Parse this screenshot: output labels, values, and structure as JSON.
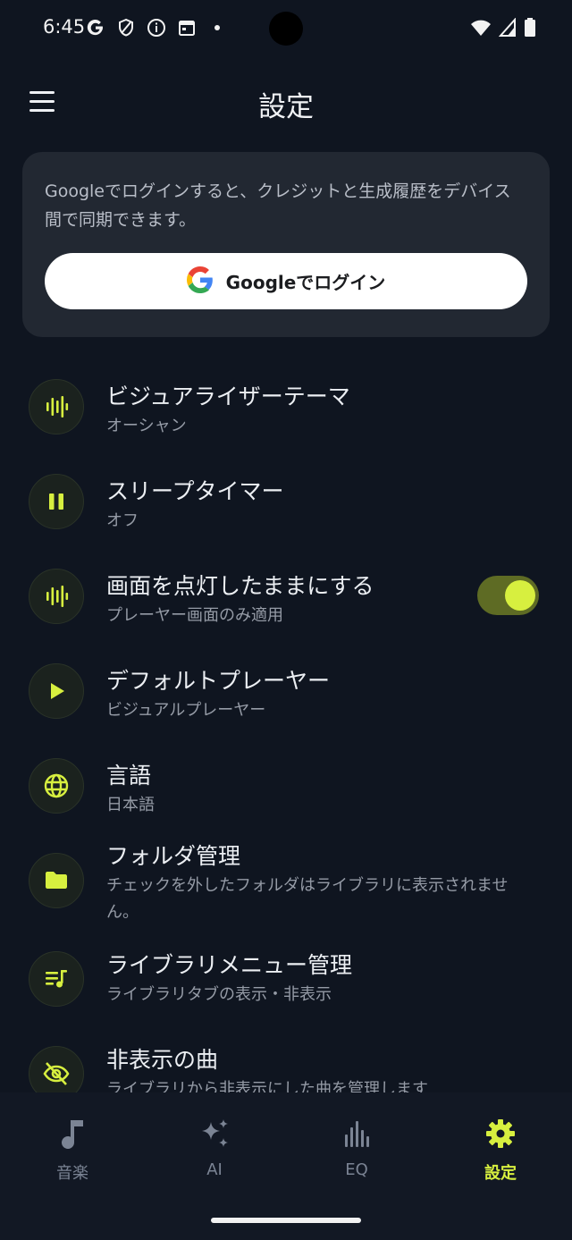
{
  "status_bar": {
    "time": "6:45",
    "left_icons": [
      "google-g-icon",
      "shield-icon",
      "info-icon",
      "calendar-icon",
      "dot-icon"
    ],
    "right_icons": [
      "wifi-icon",
      "signal-icon",
      "battery-icon"
    ]
  },
  "app_bar": {
    "title": "設定",
    "menu_icon": "hamburger-menu-icon"
  },
  "login_card": {
    "description": "Googleでログインすると、クレジットと生成履歴をデバイス間で同期できます。",
    "button_label": "Googleでログイン",
    "button_icon": "google-logo-icon"
  },
  "settings": [
    {
      "title": "ビジュアライザーテーマ",
      "subtitle": "オーシャン",
      "icon": "visualizer-bars-icon"
    },
    {
      "title": "スリープタイマー",
      "subtitle": "オフ",
      "icon": "pause-icon"
    },
    {
      "title": "画面を点灯したままにする",
      "subtitle": "プレーヤー画面のみ適用",
      "icon": "visualizer-bars-icon",
      "toggle_on": true
    },
    {
      "title": "デフォルトプレーヤー",
      "subtitle": "ビジュアルプレーヤー",
      "icon": "play-icon"
    },
    {
      "title": "言語",
      "subtitle": "日本語",
      "icon": "globe-icon"
    },
    {
      "title": "フォルダ管理",
      "subtitle": "チェックを外したフォルダはライブラリに表示されません。",
      "icon": "folder-icon"
    },
    {
      "title": "ライブラリメニュー管理",
      "subtitle": "ライブラリタブの表示・非表示",
      "icon": "queue-music-icon"
    },
    {
      "title": "非表示の曲",
      "subtitle": "ライブラリから非表示にした曲を管理します",
      "icon": "eye-off-icon"
    }
  ],
  "bottom_nav": [
    {
      "label": "音楽",
      "icon": "music-note-icon",
      "active": false
    },
    {
      "label": "AI",
      "icon": "sparkles-icon",
      "active": false
    },
    {
      "label": "EQ",
      "icon": "equalizer-icon",
      "active": false
    },
    {
      "label": "設定",
      "icon": "gear-icon",
      "active": true
    }
  ],
  "colors": {
    "background": "#0f1520",
    "card": "#222832",
    "accent": "#d7ef3f",
    "toggle_track": "#5e6b24",
    "inactive_nav": "#7b8494"
  }
}
